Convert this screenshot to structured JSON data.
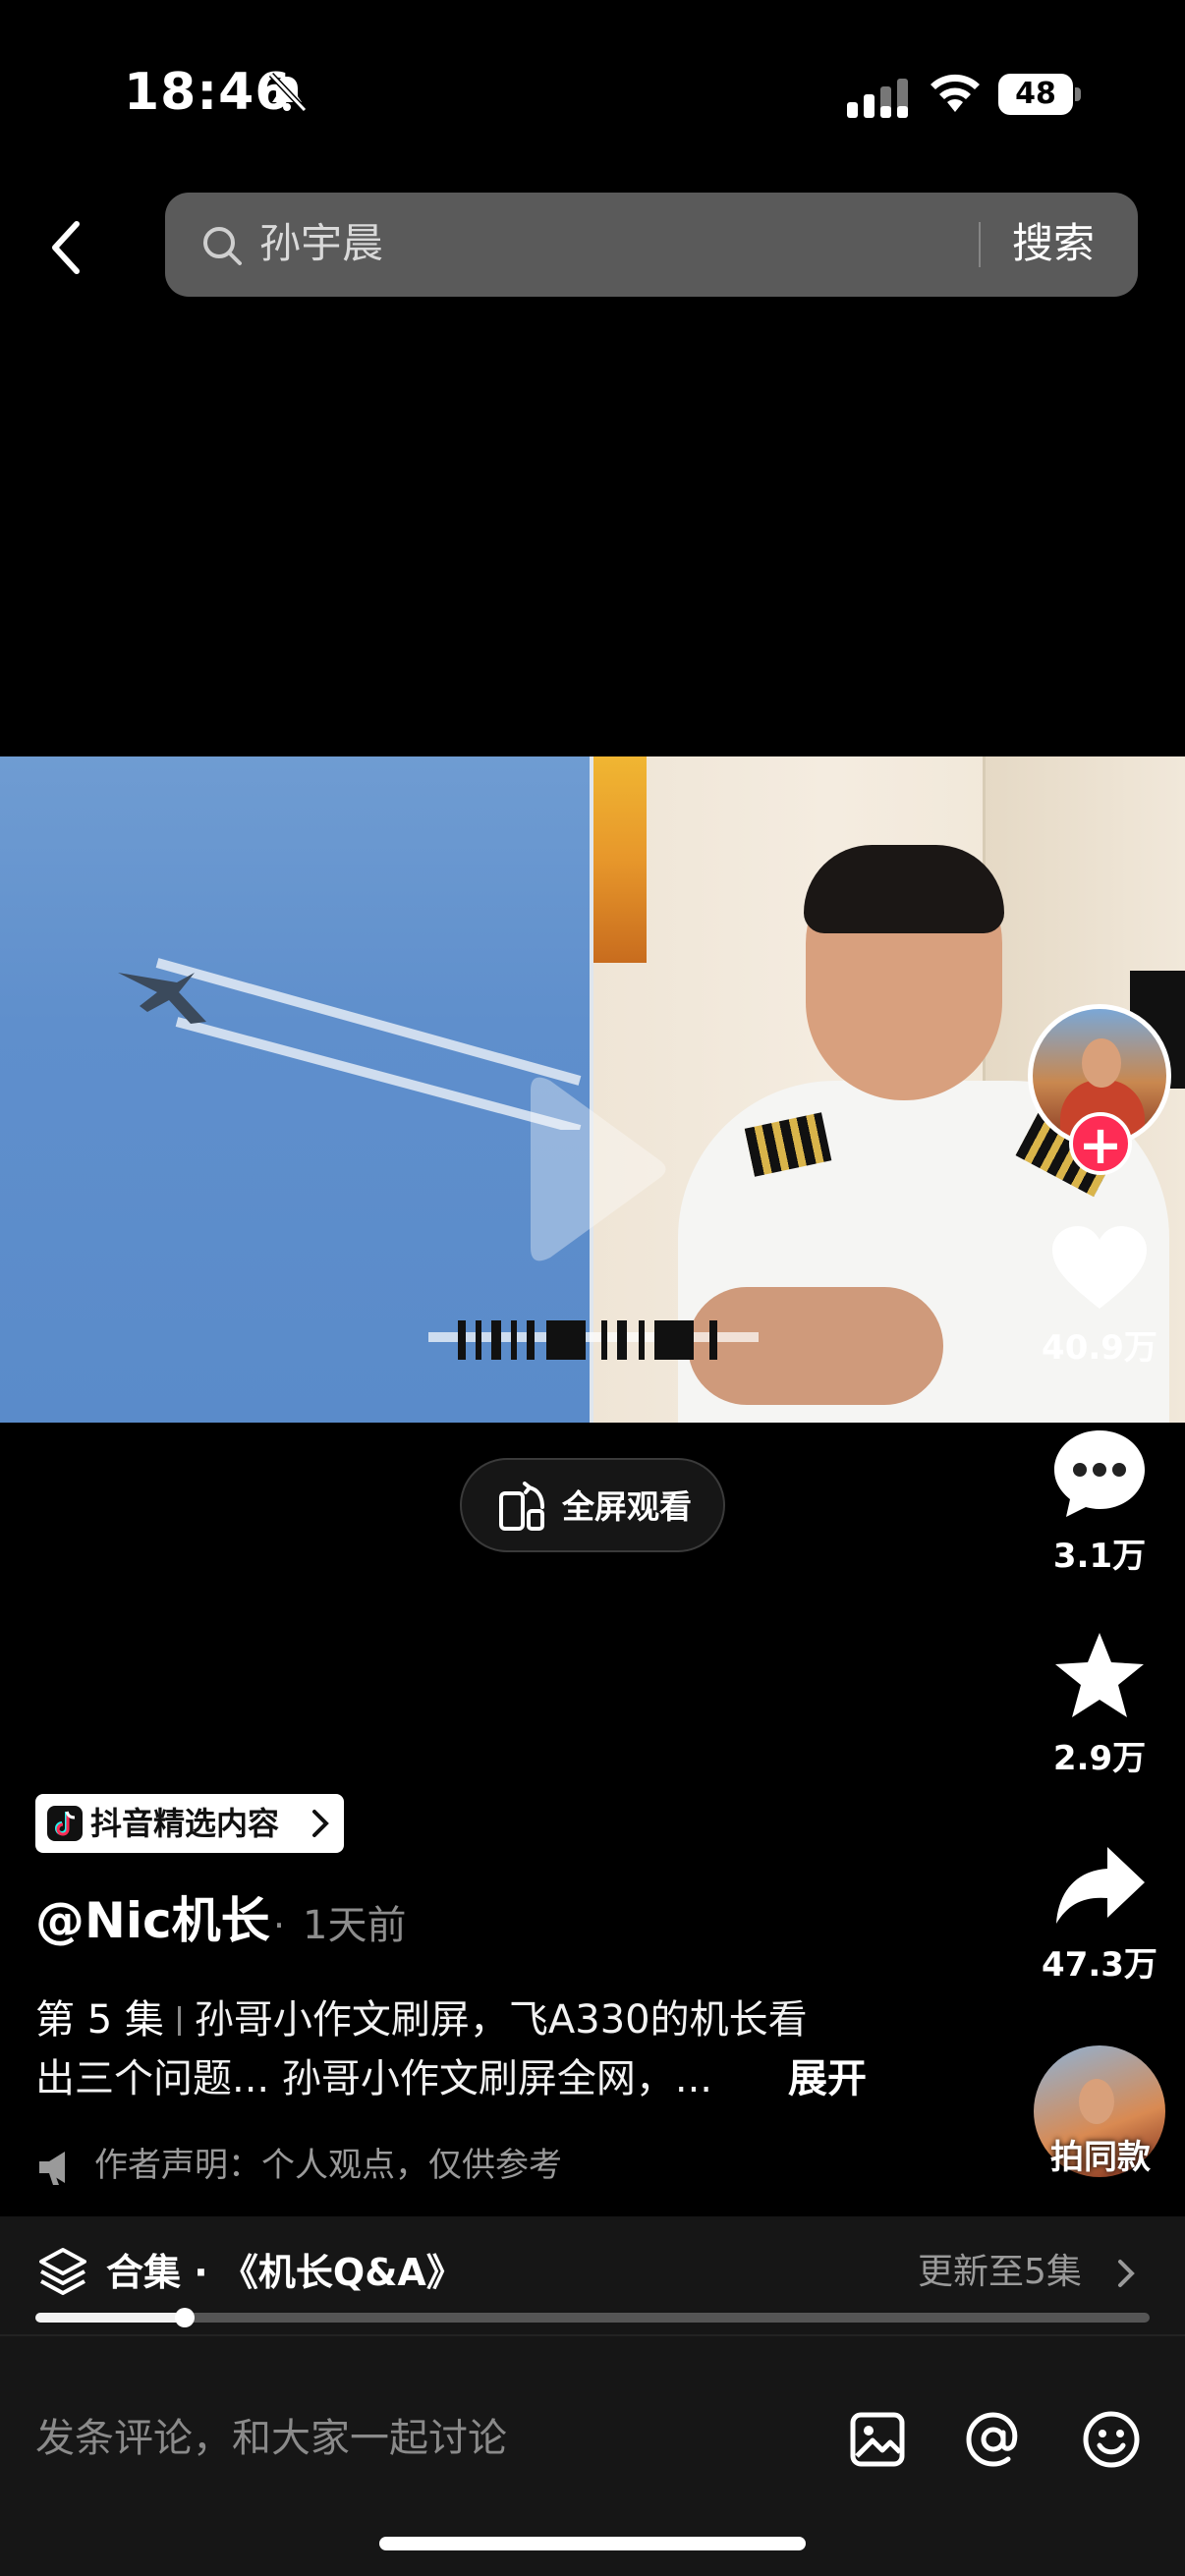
{
  "status_bar": {
    "time": "18:46",
    "battery": "48",
    "icons": [
      "bell-off-icon",
      "cellular-signal-icon",
      "wifi-icon",
      "battery-icon"
    ]
  },
  "search": {
    "query": "孙宇晨",
    "button_label": "搜索"
  },
  "video": {
    "fullscreen_label": "全屏观看"
  },
  "actions": {
    "likes": "40.9万",
    "comments": "3.1万",
    "favorites": "2.9万",
    "shares": "47.3万",
    "follow_symbol": "+",
    "same_style_label": "拍同款"
  },
  "post": {
    "tag_label": "抖音精选内容",
    "author": "@Nic机长",
    "separator": "·",
    "time": "1天前",
    "episode": "第 5 集",
    "description_line1": "孙哥小作文刷屏，飞A330的机长看",
    "description_line2": "出三个问题... 孙哥小作文刷屏全网，...",
    "expand_label": "展开",
    "notice": "作者声明：个人观点，仅供参考"
  },
  "collection": {
    "title": "合集 · 《机长Q&A》",
    "update": "更新至5集",
    "progress": 0.134
  },
  "comment_bar": {
    "placeholder": "发条评论，和大家一起讨论",
    "icons": [
      "image-icon",
      "mention-icon",
      "emoji-icon"
    ]
  }
}
